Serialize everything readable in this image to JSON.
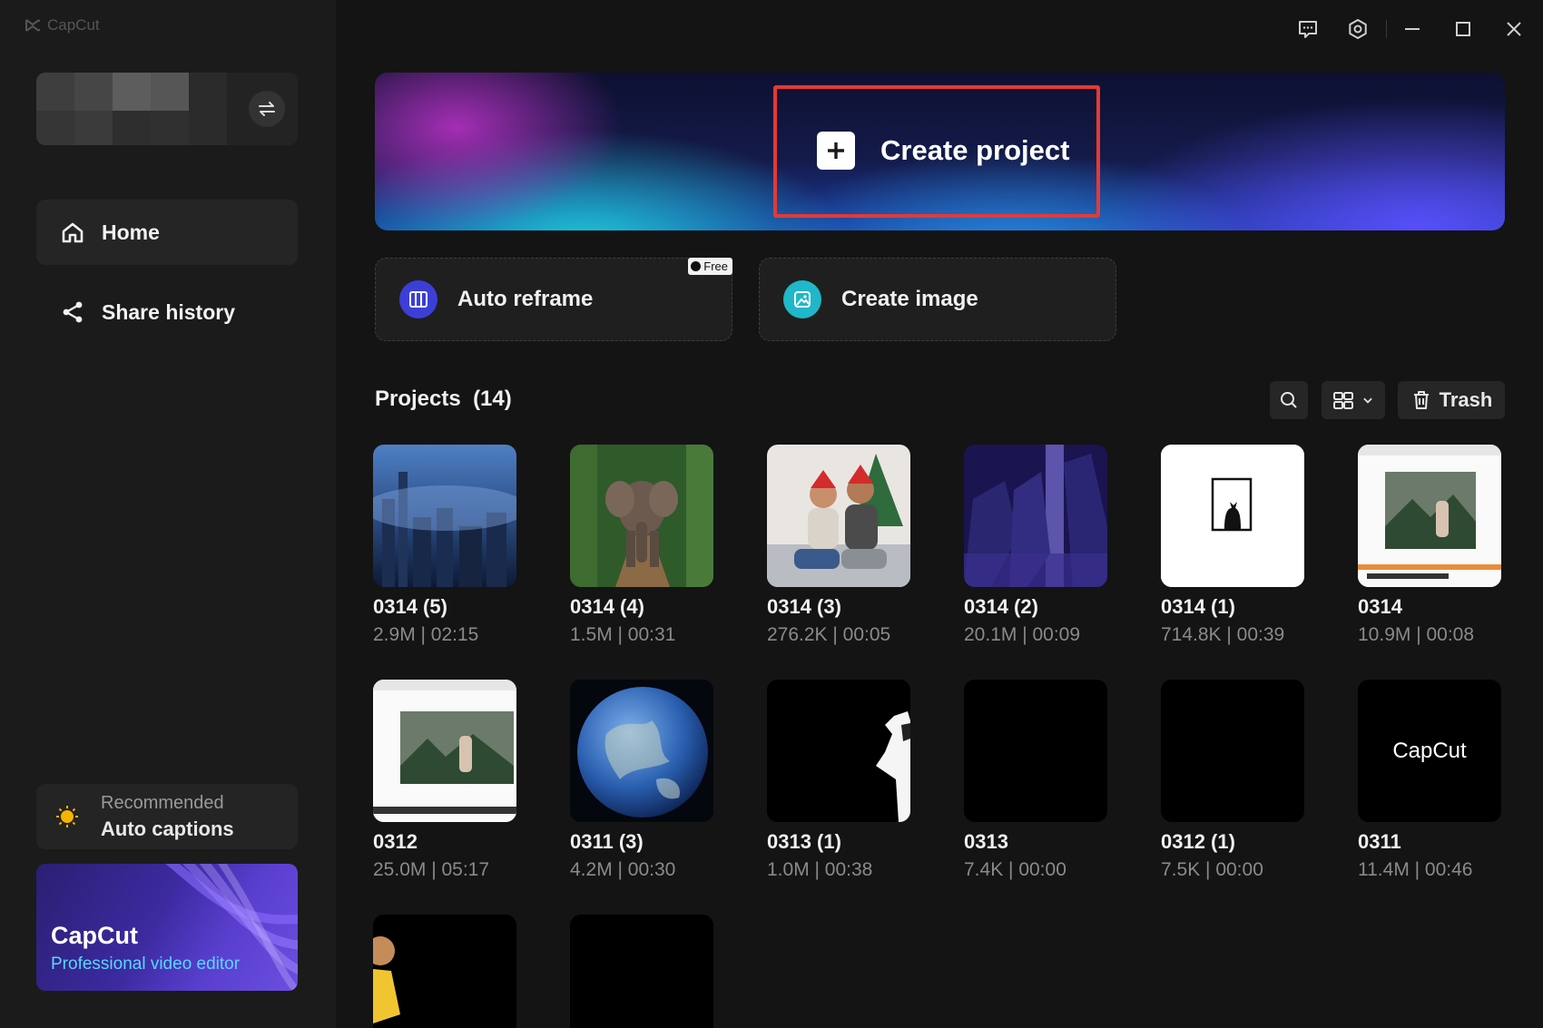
{
  "app": {
    "name": "CapCut"
  },
  "sidebar": {
    "nav": [
      {
        "label": "Home",
        "icon": "home-icon",
        "active": true
      },
      {
        "label": "Share history",
        "icon": "share-icon",
        "active": false
      }
    ],
    "recommended": {
      "title": "Recommended",
      "item": "Auto captions"
    },
    "promo": {
      "title": "CapCut",
      "subtitle": "Professional video editor"
    }
  },
  "hero": {
    "create_label": "Create project"
  },
  "actions": [
    {
      "label": "Auto reframe",
      "badge": "Free",
      "icon": "reframe-icon",
      "color": "#3b3fd8"
    },
    {
      "label": "Create image",
      "badge": "",
      "icon": "image-icon",
      "color": "#1fb7c9"
    }
  ],
  "projects": {
    "title": "Projects",
    "count": "(14)",
    "trash_label": "Trash",
    "items": [
      {
        "name": "0314 (5)",
        "meta": "2.9M | 02:15"
      },
      {
        "name": "0314 (4)",
        "meta": "1.5M | 00:31"
      },
      {
        "name": "0314 (3)",
        "meta": "276.2K | 00:05"
      },
      {
        "name": "0314 (2)",
        "meta": "20.1M | 00:09"
      },
      {
        "name": "0314 (1)",
        "meta": "714.8K | 00:39"
      },
      {
        "name": "0314",
        "meta": "10.9M | 00:08"
      },
      {
        "name": "0312",
        "meta": "25.0M | 05:17"
      },
      {
        "name": "0311 (3)",
        "meta": "4.2M | 00:30"
      },
      {
        "name": "0313 (1)",
        "meta": "1.0M | 00:38"
      },
      {
        "name": "0313",
        "meta": "7.4K | 00:00"
      },
      {
        "name": "0312 (1)",
        "meta": "7.5K | 00:00"
      },
      {
        "name": "0311",
        "meta": "11.4M | 00:46",
        "thumb_text": "CapCut"
      },
      {
        "name": "",
        "meta": ""
      },
      {
        "name": "",
        "meta": ""
      }
    ]
  }
}
